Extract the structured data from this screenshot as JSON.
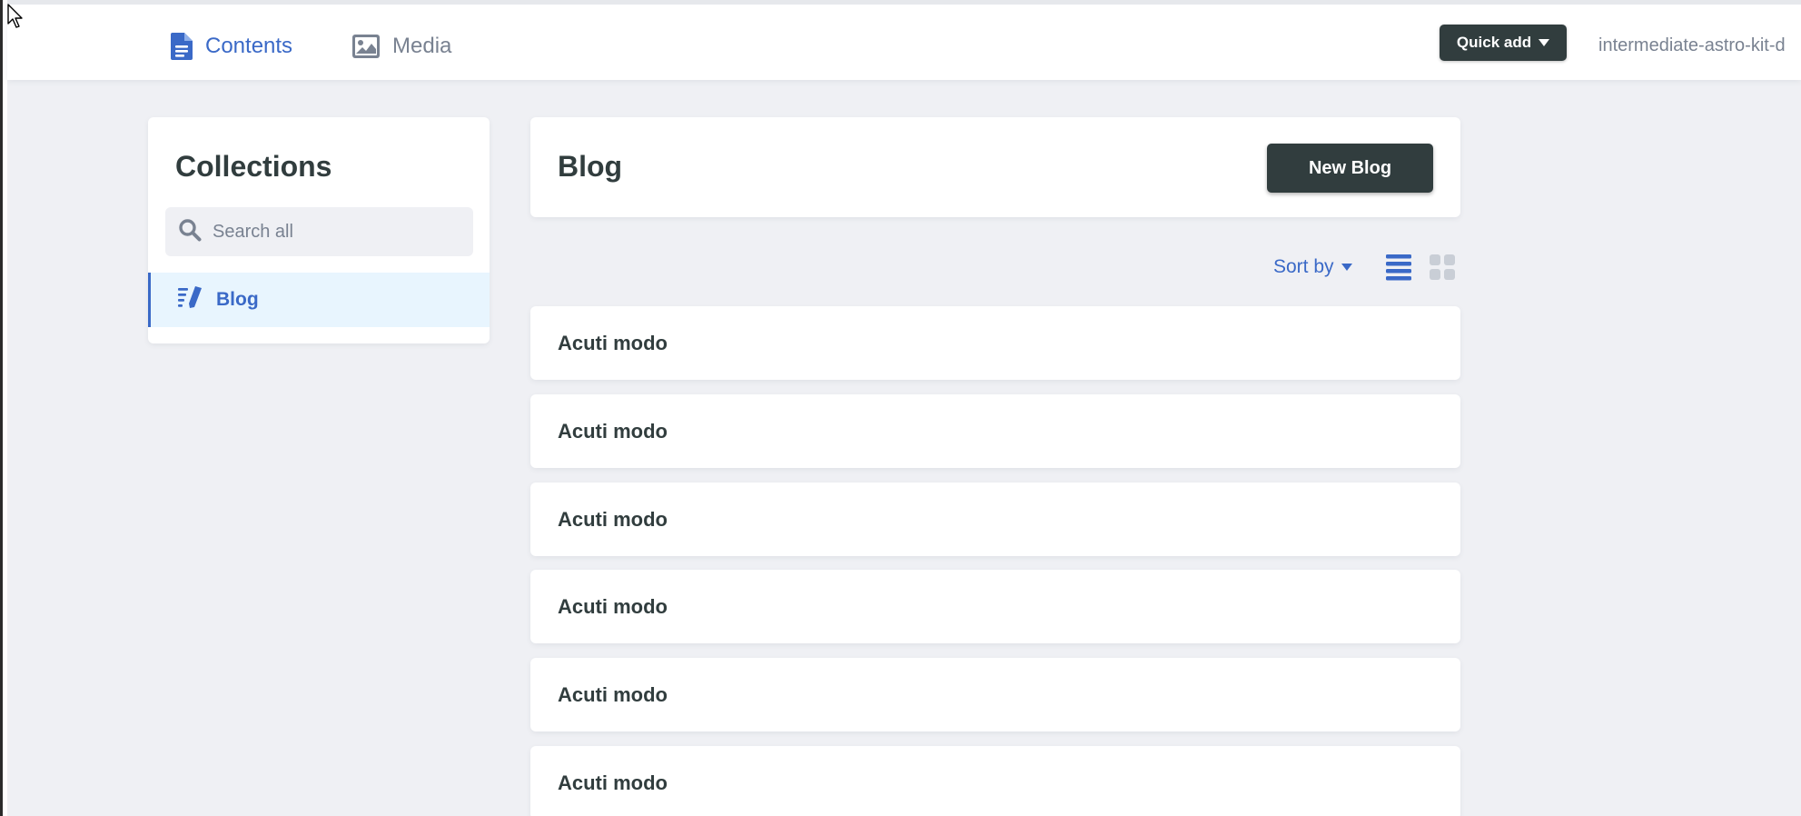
{
  "topbar": {
    "nav": [
      {
        "label": "Contents",
        "icon": "document-icon",
        "active": true
      },
      {
        "label": "Media",
        "icon": "image-icon",
        "active": false
      }
    ],
    "quick_add_label": "Quick add",
    "site_name": "intermediate-astro-kit-d"
  },
  "sidebar": {
    "title": "Collections",
    "search_placeholder": "Search all",
    "items": [
      {
        "label": "Blog",
        "icon": "blog-collection-icon",
        "active": true
      }
    ]
  },
  "collection": {
    "title": "Blog",
    "new_button_label": "New Blog",
    "sort_label": "Sort by",
    "view_modes": [
      "list-view-icon",
      "grid-view-icon"
    ],
    "entries": [
      {
        "title": "Acuti modo"
      },
      {
        "title": "Acuti modo"
      },
      {
        "title": "Acuti modo"
      },
      {
        "title": "Acuti modo"
      },
      {
        "title": "Acuti modo"
      },
      {
        "title": "Acuti modo"
      }
    ]
  },
  "colors": {
    "accent": "#3a69c7",
    "dark_button": "#313d3e",
    "background": "#eff0f4",
    "active_item_bg": "#e8f5fe",
    "muted_text": "#798291"
  }
}
